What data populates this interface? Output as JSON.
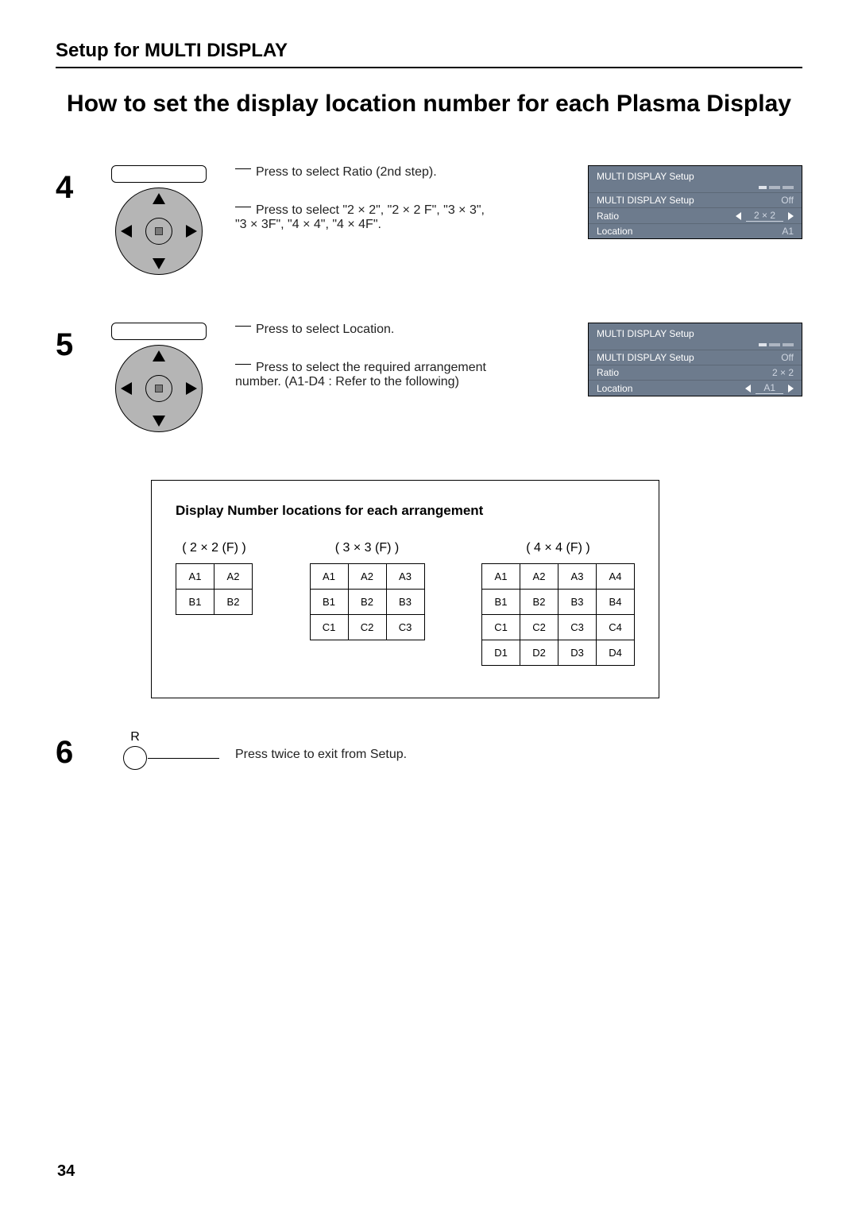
{
  "section_title": "Setup for MULTI DISPLAY",
  "main_title": "How to set the display location number for each Plasma Display",
  "steps": {
    "s4": {
      "num": "4",
      "line1": "Press to select Ratio (2nd step).",
      "line2": "Press to select \"2 × 2\", \"2 × 2 F\", \"3 × 3\", \"3 × 3F\", \"4 × 4\", \"4 × 4F\"."
    },
    "s5": {
      "num": "5",
      "line1": "Press to select Location.",
      "line2": "Press to select the required arrangement number. (A1-D4 : Refer to the following)"
    },
    "s6": {
      "num": "6",
      "r_label": "R",
      "line1": "Press twice to exit from Setup."
    }
  },
  "osd4": {
    "title": "MULTI DISPLAY Setup",
    "r1_label": "MULTI DISPLAY Setup",
    "r1_val": "Off",
    "r2_label": "Ratio",
    "r2_val": "2 × 2",
    "r3_label": "Location",
    "r3_val": "A1"
  },
  "osd5": {
    "title": "MULTI DISPLAY Setup",
    "r1_label": "MULTI DISPLAY Setup",
    "r1_val": "Off",
    "r2_label": "Ratio",
    "r2_val": "2 × 2",
    "r3_label": "Location",
    "r3_val": "A1"
  },
  "arr": {
    "heading": "Display Number locations for each arrangement",
    "g2_label": "( 2 × 2 (F) )",
    "g3_label": "( 3 × 3 (F) )",
    "g4_label": "( 4 × 4 (F) )"
  },
  "chart_data": [
    {
      "type": "table",
      "title": "( 2 × 2 (F) )",
      "values": [
        [
          "A1",
          "A2"
        ],
        [
          "B1",
          "B2"
        ]
      ]
    },
    {
      "type": "table",
      "title": "( 3 × 3 (F) )",
      "values": [
        [
          "A1",
          "A2",
          "A3"
        ],
        [
          "B1",
          "B2",
          "B3"
        ],
        [
          "C1",
          "C2",
          "C3"
        ]
      ]
    },
    {
      "type": "table",
      "title": "( 4 × 4 (F) )",
      "values": [
        [
          "A1",
          "A2",
          "A3",
          "A4"
        ],
        [
          "B1",
          "B2",
          "B3",
          "B4"
        ],
        [
          "C1",
          "C2",
          "C3",
          "C4"
        ],
        [
          "D1",
          "D2",
          "D3",
          "D4"
        ]
      ]
    }
  ],
  "page_number": "34"
}
